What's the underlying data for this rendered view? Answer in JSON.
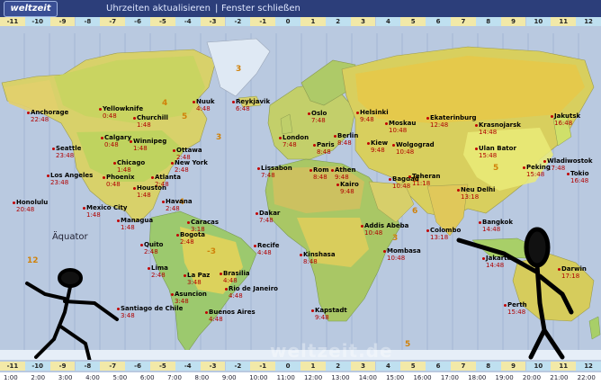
{
  "header": {
    "logo": "weltzeit",
    "update_link": "Uhrzeiten aktualisieren",
    "separator": "|",
    "close_link": "Fenster schließen"
  },
  "zones": [
    "-11",
    "-10",
    "-9",
    "-8",
    "-7",
    "-6",
    "-5",
    "-4",
    "-3",
    "-2",
    "-1",
    "0",
    "1",
    "2",
    "3",
    "4",
    "5",
    "6",
    "7",
    "8",
    "9",
    "10",
    "11",
    "12"
  ],
  "bottom_times": [
    "1:00",
    "2:00",
    "3:00",
    "4:00",
    "5:00",
    "6:00",
    "7:00",
    "8:00",
    "9:00",
    "10:00",
    "11:00",
    "12:00",
    "13:00",
    "14:00",
    "15:00",
    "16:00",
    "17:00",
    "18:00",
    "19:00",
    "20:00",
    "21:00",
    "22:00"
  ],
  "labels": {
    "equator": "Äquator",
    "watermark": "weltzeit.de"
  },
  "map_zone_marks": [
    "3",
    "4",
    "5",
    "5",
    "6",
    "6",
    "5",
    "-3",
    "-4",
    "3",
    "3",
    "12"
  ],
  "cities": [
    {
      "name": "Anchorage",
      "time": "22:48"
    },
    {
      "name": "Yellowknife",
      "time": "0:48"
    },
    {
      "name": "Churchill",
      "time": "1:48"
    },
    {
      "name": "Calgary",
      "time": "0:48"
    },
    {
      "name": "Winnipeg",
      "time": "1:48"
    },
    {
      "name": "Nuuk",
      "time": "4:48"
    },
    {
      "name": "Reykjavik",
      "time": "6:48"
    },
    {
      "name": "Oslo",
      "time": "7:48"
    },
    {
      "name": "Helsinki",
      "time": "9:48"
    },
    {
      "name": "Moskau",
      "time": "10:48"
    },
    {
      "name": "Ekaterinburg",
      "time": "12:48"
    },
    {
      "name": "Krasnojarsk",
      "time": "14:48"
    },
    {
      "name": "Jakutsk",
      "time": "16:48"
    },
    {
      "name": "Seattle",
      "time": "23:48"
    },
    {
      "name": "Chicago",
      "time": "1:48"
    },
    {
      "name": "Ottawa",
      "time": "2:48"
    },
    {
      "name": "New York",
      "time": "2:48"
    },
    {
      "name": "London",
      "time": "7:48"
    },
    {
      "name": "Paris",
      "time": "8:48"
    },
    {
      "name": "Berlin",
      "time": "8:48"
    },
    {
      "name": "Kiew",
      "time": "9:48"
    },
    {
      "name": "Wolgograd",
      "time": "10:48"
    },
    {
      "name": "Ulan Bator",
      "time": "15:48"
    },
    {
      "name": "Wladiwostok",
      "time": "17:48"
    },
    {
      "name": "Los Angeles",
      "time": "23:48"
    },
    {
      "name": "Phoenix",
      "time": "0:48"
    },
    {
      "name": "Atlanta",
      "time": "2:48"
    },
    {
      "name": "Houston",
      "time": "1:48"
    },
    {
      "name": "Lissabon",
      "time": "7:48"
    },
    {
      "name": "Rom",
      "time": "8:48"
    },
    {
      "name": "Athen",
      "time": "9:48"
    },
    {
      "name": "Bagdad",
      "time": "10:48"
    },
    {
      "name": "Teheran",
      "time": "11:18"
    },
    {
      "name": "Peking",
      "time": "15:48"
    },
    {
      "name": "Tokio",
      "time": "16:48"
    },
    {
      "name": "Honolulu",
      "time": "20:48"
    },
    {
      "name": "Mexico City",
      "time": "1:48"
    },
    {
      "name": "Havana",
      "time": "2:48"
    },
    {
      "name": "Kairo",
      "time": "9:48"
    },
    {
      "name": "Neu Delhi",
      "time": "13:18"
    },
    {
      "name": "Managua",
      "time": "1:48"
    },
    {
      "name": "Caracas",
      "time": "3:18"
    },
    {
      "name": "Bogota",
      "time": "2:48"
    },
    {
      "name": "Dakar",
      "time": "7:48"
    },
    {
      "name": "Addis Abeba",
      "time": "10:48"
    },
    {
      "name": "Bangkok",
      "time": "14:48"
    },
    {
      "name": "Colombo",
      "time": "13:18"
    },
    {
      "name": "Quito",
      "time": "2:48"
    },
    {
      "name": "Recife",
      "time": "4:48"
    },
    {
      "name": "Kinshasa",
      "time": "8:48"
    },
    {
      "name": "Mombasa",
      "time": "10:48"
    },
    {
      "name": "Lima",
      "time": "2:48"
    },
    {
      "name": "La Paz",
      "time": "3:48"
    },
    {
      "name": "Brasilia",
      "time": "4:48"
    },
    {
      "name": "Jakarta",
      "time": "14:48"
    },
    {
      "name": "Asuncion",
      "time": "3:48"
    },
    {
      "name": "Rio de Janeiro",
      "time": "4:48"
    },
    {
      "name": "Darwin",
      "time": "17:18"
    },
    {
      "name": "Santiago de Chile",
      "time": "3:48"
    },
    {
      "name": "Buenos Aires",
      "time": "4:48"
    },
    {
      "name": "Kapstadt",
      "time": "9:48"
    },
    {
      "name": "Perth",
      "time": "15:48"
    }
  ]
}
